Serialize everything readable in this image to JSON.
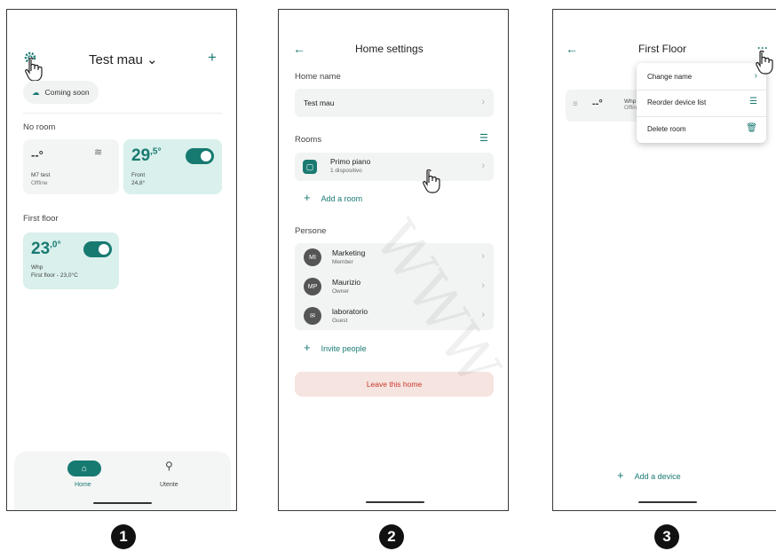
{
  "steps": [
    "1",
    "2",
    "3"
  ],
  "screen1": {
    "title": "Test mau",
    "title_chevron": "⌄",
    "add_label": "+",
    "coming_soon": "Coming soon",
    "no_room_label": "No room",
    "device1": {
      "temp": "--°",
      "name": "M7 test",
      "status": "Offline"
    },
    "device2": {
      "temp_main": "29",
      "temp_dec": ",5°",
      "name": "Front",
      "sub": "24,8°"
    },
    "first_floor_label": "First floor",
    "device3": {
      "temp_main": "23",
      "temp_dec": ",0°",
      "name": "Whp",
      "sub": "First floor - 23,0°C"
    },
    "nav_home": "Home",
    "nav_user": "Utente"
  },
  "screen2": {
    "title": "Home settings",
    "home_name_label": "Home name",
    "home_name_value": "Test mau",
    "rooms_label": "Rooms",
    "room1_name": "Primo piano",
    "room1_sub": "1 dispositivo",
    "add_room": "Add a room",
    "persone_label": "Persone",
    "people": [
      {
        "initials": "MI",
        "name": "Marketing",
        "role": "Member"
      },
      {
        "initials": "MP",
        "name": "Maurizio",
        "role": "Owner"
      },
      {
        "initials": "✉",
        "name": "laboratorio",
        "role": "Guest"
      }
    ],
    "invite": "Invite people",
    "leave": "Leave this home"
  },
  "screen3": {
    "title": "First Floor",
    "more": "···",
    "device_temp": "--°",
    "device_name": "Whp",
    "device_status": "Offlin",
    "menu": [
      "Change name",
      "Reorder device list",
      "Delete room"
    ],
    "add_device": "Add a device"
  },
  "watermark": "WWW",
  "accent": "#1a7a72"
}
